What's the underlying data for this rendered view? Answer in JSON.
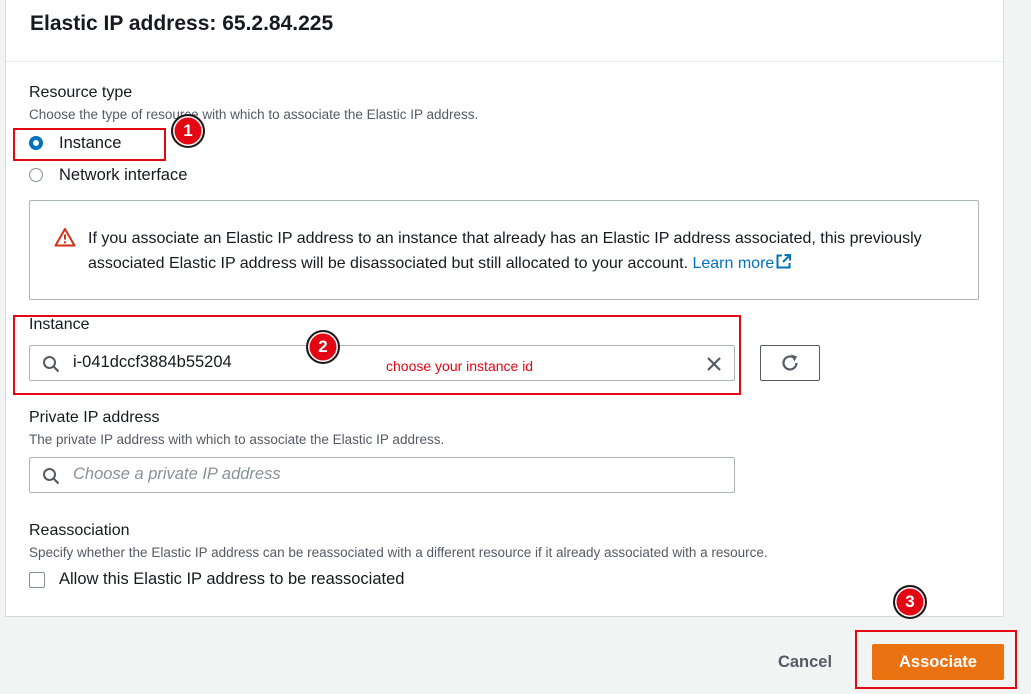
{
  "header": {
    "title": "Elastic IP address: 65.2.84.225"
  },
  "resource_type": {
    "label": "Resource type",
    "description": "Choose the type of resource with which to associate the Elastic IP address.",
    "options": [
      {
        "label": "Instance",
        "checked": true
      },
      {
        "label": "Network interface",
        "checked": false
      }
    ]
  },
  "alert": {
    "icon": "warning-icon",
    "text": "If you associate an Elastic IP address to an instance that already has an Elastic IP address associated, this previously associated Elastic IP address will be disassociated but still allocated to your account.",
    "link": "Learn more"
  },
  "instance": {
    "label": "Instance",
    "value": "i-041dccf3884b55204"
  },
  "private_ip": {
    "label": "Private IP address",
    "description": "The private IP address with which to associate the Elastic IP address.",
    "placeholder": "Choose a private IP address"
  },
  "reassociation": {
    "label": "Reassociation",
    "description": "Specify whether the Elastic IP address can be reassociated with a different resource if it already associated with a resource.",
    "checkbox_label": "Allow this Elastic IP address to be reassociated"
  },
  "footer": {
    "cancel": "Cancel",
    "associate": "Associate"
  },
  "annotations": {
    "step1": "1",
    "step2": "2",
    "step3": "3",
    "note": "choose your instance id",
    "color": "#e30613"
  },
  "colors": {
    "primary": "#ec7211",
    "link": "#0073bb",
    "radio": "#0073bb"
  }
}
